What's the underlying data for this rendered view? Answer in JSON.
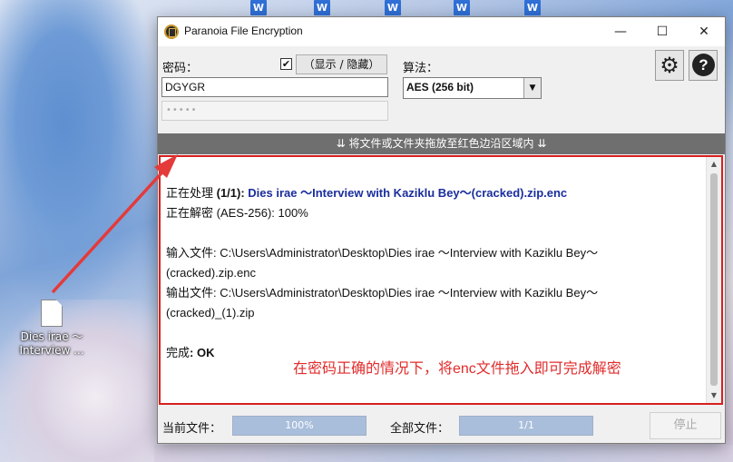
{
  "desktop": {
    "tile_glyph": "W",
    "file_label_1": "Dies irae ～",
    "file_label_2": "Interview ..."
  },
  "window": {
    "title": "Paranoia File Encryption",
    "minimize": "—",
    "maximize": "☐",
    "close": "✕"
  },
  "password": {
    "label": "密码：",
    "show_checked": "✔",
    "show_hide_label": "（显示 / 隐藏）",
    "value": "DGYGR",
    "confirm_mask": "•••••"
  },
  "algorithm": {
    "label": "算法：",
    "selected": "AES (256 bit)"
  },
  "icons": {
    "settings": "gear-icon",
    "help": "help-icon"
  },
  "drop_bar": "⇊ 将文件或文件夹拖放至红色边沿区域内 ⇊",
  "log": {
    "processing_prefix": "正在处理 ",
    "processing_count": "(1/1): ",
    "processing_file": "Dies irae ～Interview with Kaziklu Bey～(cracked).zip.enc",
    "decrypting": "正在解密 (AES-256): 100%",
    "input_line1": "输入文件: C:\\Users\\Administrator\\Desktop\\Dies irae ～Interview with Kaziklu Bey～",
    "input_line2": "(cracked).zip.enc",
    "output_line1": "输出文件: C:\\Users\\Administrator\\Desktop\\Dies irae ～Interview with Kaziklu Bey～",
    "output_line2": "(cracked)_(1).zip",
    "done_prefix": "完成",
    "done_value": ": OK"
  },
  "annotation": "在密码正确的情况下，将enc文件拖入即可完成解密",
  "progress": {
    "current_label": "当前文件：",
    "current_value": "100%",
    "current_fraction": 1.0,
    "all_label": "全部文件：",
    "all_value": "1/1",
    "all_fraction": 1.0
  },
  "stop_button": "停止",
  "colors": {
    "accent_red": "#d81f1f",
    "link_blue": "#1a2e9c",
    "annotation_red": "#e22b2b"
  }
}
